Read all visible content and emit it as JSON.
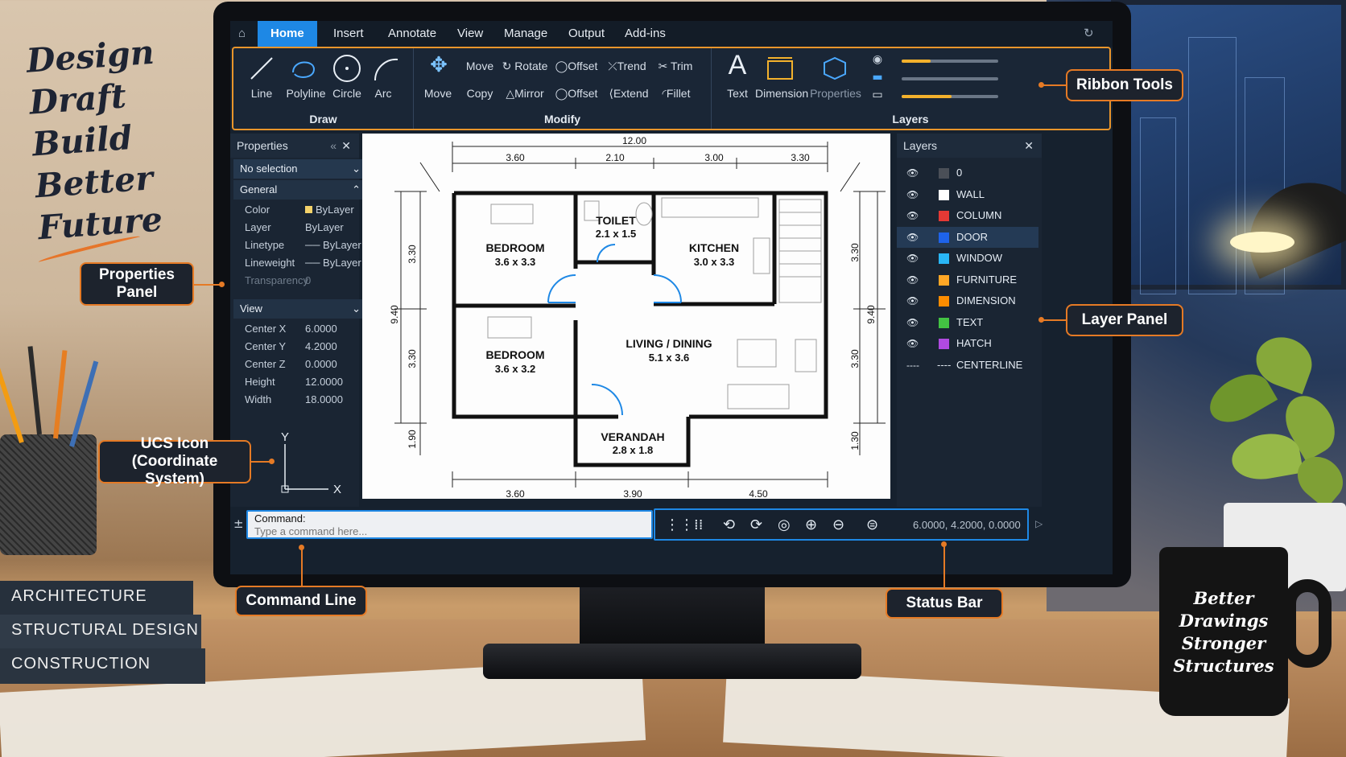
{
  "background": {
    "handwritten": [
      "Design",
      "Draft",
      "Build",
      "Better",
      "Future"
    ],
    "books": [
      "ARCHITECTURE",
      "STRUCTURAL DESIGN",
      "CONSTRUCTION"
    ],
    "mug_text": [
      "Better",
      "Drawings",
      "Stronger",
      "Structures"
    ]
  },
  "callouts": {
    "properties_panel": "Properties Panel",
    "ucs_icon": "UCS Icon (Coordinate System)",
    "command_line": "Command Line",
    "ribbon_tools": "Ribbon Tools",
    "layer_panel": "Layer Panel",
    "status_bar": "Status Bar"
  },
  "menubar": {
    "tabs": [
      "Home",
      "Insert",
      "Annotate",
      "View",
      "Manage",
      "Output",
      "Add-ins"
    ],
    "active": "Home"
  },
  "ribbon": {
    "draw": {
      "title": "Draw",
      "tools": [
        "Line",
        "Polyline",
        "Circle",
        "Arc"
      ]
    },
    "modify": {
      "title": "Modify",
      "large": [
        "Move",
        "Copy"
      ],
      "row1": [
        "Move",
        "Rotate",
        "Offset",
        "Trend",
        "Trim"
      ],
      "row2": [
        "Copy",
        "Mirror",
        "Offset",
        "Extend",
        "Fillet"
      ]
    },
    "layers": {
      "title": "Layers",
      "tools": [
        "Text",
        "Dimension",
        "Properties"
      ],
      "sliders": [
        0.3,
        0.0,
        0.52
      ]
    }
  },
  "properties": {
    "title": "Properties",
    "selection": "No selection",
    "general_title": "General",
    "general": [
      {
        "k": "Color",
        "v": "ByLayer"
      },
      {
        "k": "Layer",
        "v": "ByLayer"
      },
      {
        "k": "Linetype",
        "v": "ByLayer"
      },
      {
        "k": "Lineweight",
        "v": "ByLayer"
      },
      {
        "k": "Transparency",
        "v": "0"
      }
    ],
    "view_title": "View",
    "view": [
      {
        "k": "Center X",
        "v": "6.0000"
      },
      {
        "k": "Center Y",
        "v": "4.2000"
      },
      {
        "k": "Center Z",
        "v": "0.0000"
      },
      {
        "k": "Height",
        "v": "12.0000"
      },
      {
        "k": "Width",
        "v": "18.0000"
      }
    ],
    "ucs_y": "Y",
    "ucs_x": "X"
  },
  "drawing": {
    "overall_top": "12.00",
    "top_dims": [
      "3.60",
      "2.10",
      "3.00",
      "3.30"
    ],
    "bottom_dims": [
      "3.60",
      "3.90",
      "4.50"
    ],
    "left_dims": [
      "3.30",
      "9.40",
      "3.30",
      "1.90"
    ],
    "right_dims": [
      "3.30",
      "9.40",
      "3.30",
      "1.30"
    ],
    "rooms": [
      {
        "name": "BEDROOM",
        "size": "3.6 x 3.3"
      },
      {
        "name": "TOILET",
        "size": "2.1 x 1.5"
      },
      {
        "name": "KITCHEN",
        "size": "3.0 x 3.3"
      },
      {
        "name": "BEDROOM",
        "size": "3.6 x 3.2"
      },
      {
        "name": "LIVING / DINING",
        "size": "5.1 x 3.6"
      },
      {
        "name": "VERANDAH",
        "size": "2.8 x 1.8"
      }
    ]
  },
  "layers": {
    "title": "Layers",
    "items": [
      {
        "name": "0",
        "color": "#4a4f57"
      },
      {
        "name": "WALL",
        "color": "#ffffff"
      },
      {
        "name": "COLUMN",
        "color": "#e53935"
      },
      {
        "name": "DOOR",
        "color": "#1e63e9"
      },
      {
        "name": "WINDOW",
        "color": "#29b6f6"
      },
      {
        "name": "FURNITURE",
        "color": "#ffa726"
      },
      {
        "name": "DIMENSION",
        "color": "#fb8c00"
      },
      {
        "name": "TEXT",
        "color": "#43c343"
      },
      {
        "name": "HATCH",
        "color": "#b04ae0"
      },
      {
        "name": "CENTERLINE",
        "color": "dashed"
      }
    ],
    "selected": "DOOR"
  },
  "command": {
    "label": "Command:",
    "placeholder": "Type a command here..."
  },
  "status": {
    "coords": "6.0000, 4.2000, 0.0000"
  }
}
